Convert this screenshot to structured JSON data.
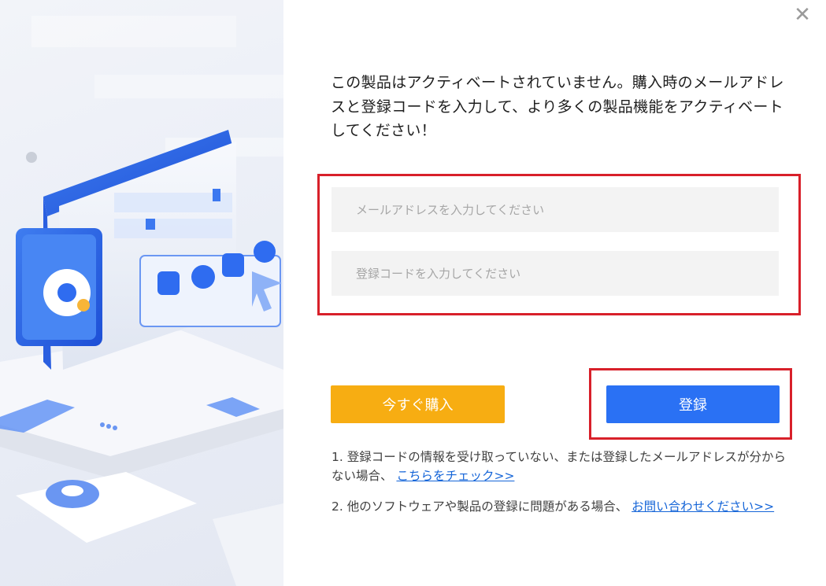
{
  "dialog": {
    "close_symbol": "✕",
    "message": "この製品はアクティベートされていません。購入時のメールアドレスと登録コードを入力して、より多くの製品機能をアクティベートしてください！",
    "email_placeholder": "メールアドレスを入力してください",
    "code_placeholder": "登録コードを入力してください",
    "buy_label": "今すぐ購入",
    "register_label": "登録",
    "note1_text": "1. 登録コードの情報を受け取っていない、または登録したメールアドレスが分からない場合、",
    "note1_link": "こちらをチェック>>",
    "note2_text": "2. 他のソフトウェアや製品の登録に問題がある場合、",
    "note2_link": "お問い合わせください>>"
  },
  "colors": {
    "buy_button": "#f7ad12",
    "register_button": "#2a71f4",
    "highlight_border": "#d8202a",
    "link": "#1565d8"
  }
}
